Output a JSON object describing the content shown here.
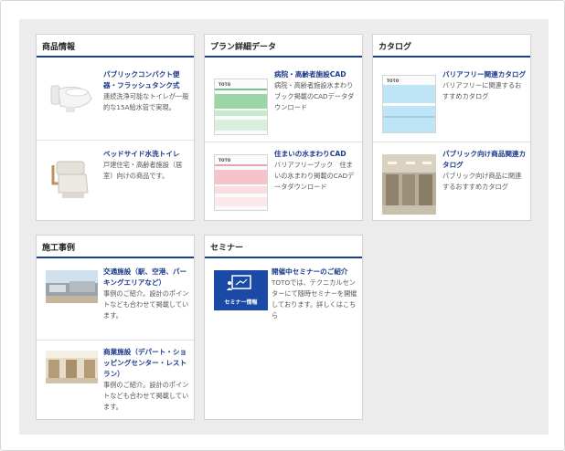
{
  "sections": {
    "products": {
      "title": "商品情報",
      "items": [
        {
          "title": "パブリックコンパクト便器・フラッシュタンク式",
          "desc": "連続洗浄可能なトイレが一般的な15A給水管で実現。",
          "icon": "toilet-image"
        },
        {
          "title": "ベッドサイド水洗トイレ",
          "desc": "戸建住宅・高齢者施設（居室）向けの商品です。",
          "icon": "bedside-toilet-image"
        }
      ]
    },
    "plans": {
      "title": "プラン詳細データ",
      "items": [
        {
          "title": "病院・高齢者施設CAD",
          "desc": "病院・高齢者施設水まわりブック掲載のCADデータダウンロード",
          "icon": "cad-brochure-image",
          "logo": "TOTO"
        },
        {
          "title": "住まいの水まわりCAD",
          "desc": "バリアフリーブック　住まいの水まわり掲載のCADデータダウンロード",
          "icon": "cad-brochure-image",
          "logo": "TOTO"
        }
      ]
    },
    "catalog": {
      "title": "カタログ",
      "items": [
        {
          "title": "バリアフリー関連カタログ",
          "desc": "バリアフリーに関連するおすすめカタログ",
          "icon": "catalog-image",
          "logo": "TOTO"
        },
        {
          "title": "パブリック向け商品関連カタログ",
          "desc": "パブリック向け商品に関連するおすすめカタログ",
          "icon": "public-restroom-photo"
        }
      ]
    },
    "cases": {
      "title": "施工事例",
      "items": [
        {
          "title": "交通施設（駅、空港、パーキングエリアなど）",
          "desc": "事例のご紹介。設計のポイントなども合わせて掲載しています。",
          "icon": "station-photo"
        },
        {
          "title": "商業施設（デパート・ショッピングセンター・レストラン）",
          "desc": "事例のご紹介。設計のポイントなども合わせて掲載しています。",
          "icon": "mall-photo"
        }
      ]
    },
    "seminar": {
      "title": "セミナー",
      "items": [
        {
          "title": "開催中セミナーのご紹介",
          "desc": "TOTOでは、テクニカルセンターにて随時セミナーを開催しております。詳しくはこちら",
          "icon": "seminar-icon",
          "badge": "セミナー情報"
        }
      ]
    }
  },
  "colors": {
    "accent": "#1b3d8f",
    "link": "#1d3b8c",
    "seminar_bg": "#1a4aa6",
    "stage_bg": "#ececec"
  }
}
